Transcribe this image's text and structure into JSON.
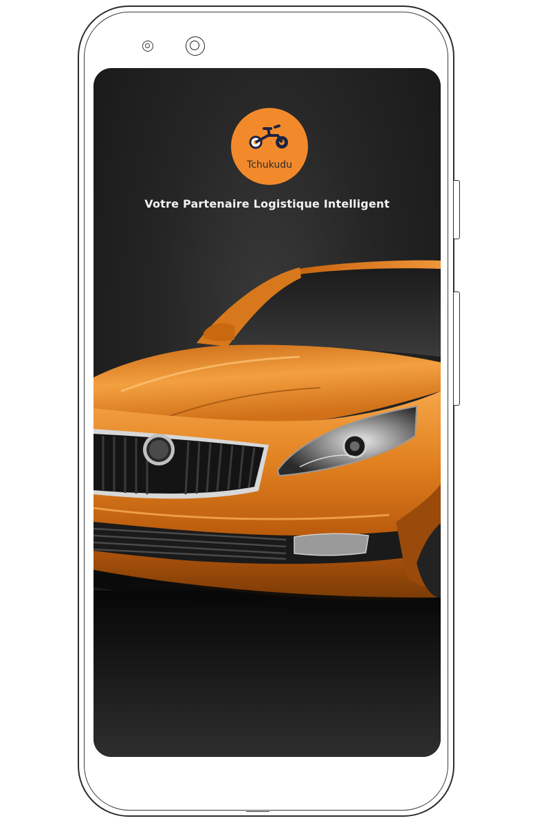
{
  "app": {
    "brand_name": "Tchukudu",
    "tagline": "Votre Partenaire Logistique Intelligent",
    "logo_icon": "delivery-bike-icon",
    "hero_image": "orange-car-photo"
  },
  "colors": {
    "brand_orange": "#f28a2b",
    "background_dark": "#1c1c1c",
    "car_orange": "#d9721a",
    "tagline_text": "#f3f3f3"
  }
}
